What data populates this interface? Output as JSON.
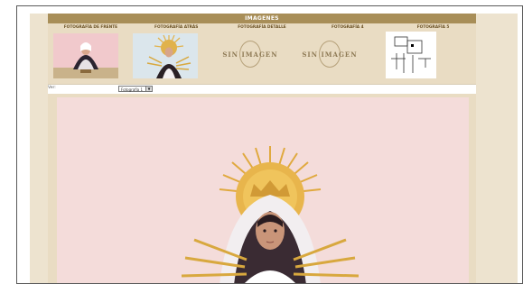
{
  "page": {
    "title": "IMAGENES",
    "columns": [
      "FOTOGRAFÍA DE FRENTE",
      "FOTOGRAFÍA ATRÁS",
      "FOTOGRAFÍA DETALLE",
      "FOTOGRAFÍA 4",
      "FOTOGRAFÍA 5"
    ],
    "no_image_text": "SIN IMAGEN",
    "view_label": "Ver:",
    "view_select_value": "Fotografía 1"
  }
}
